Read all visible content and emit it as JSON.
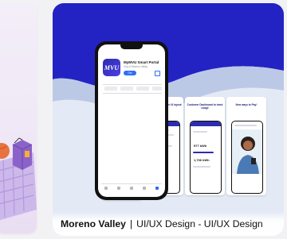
{
  "colors": {
    "brand_blue": "#2a2acb",
    "background": "#f2f2f4",
    "accent_blue": "#2f6cf5"
  },
  "left_card": {
    "illustration": "isometric-illustration"
  },
  "project": {
    "place": "Moreno Valley",
    "separator": "|",
    "disciplines": "UI/UX Design - UI/UX Design",
    "mock": {
      "app_icon_text": "MVU",
      "app_name": "MyMVU Smart Portal",
      "app_subtitle": "City of Moreno Valley",
      "get_label": "Get",
      "screenshots": [
        {
          "title": "My MVU Smart Portal"
        },
        {
          "title": "Cleaner and smarter UI layout"
        },
        {
          "title": "Customer Dashboard to track usage"
        },
        {
          "title": "New ways to Pay!"
        }
      ],
      "usage_values": [
        "577 kWh",
        "1,736 kWh"
      ]
    }
  }
}
